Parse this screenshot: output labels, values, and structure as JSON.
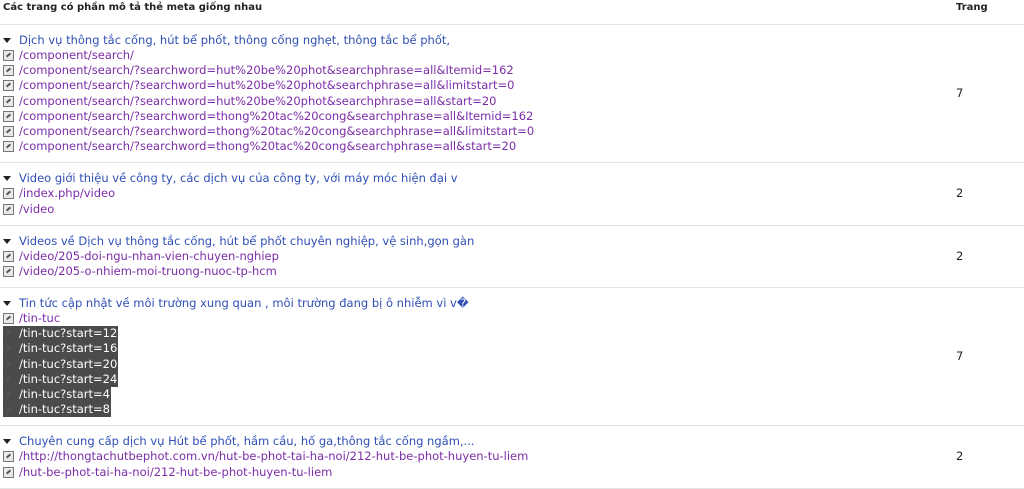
{
  "header": {
    "col_desc": "Các trang có phần mô tả thẻ meta giống nhau",
    "col_count": "Trang"
  },
  "groups": [
    {
      "title": "Dịch vụ thông tắc cống, hút bể phốt, thông cống nghẹt, thông tắc bể phốt,",
      "count": "7",
      "urls": [
        "/component/search/",
        "/component/search/?searchword=hut%20be%20phot&searchphrase=all&Itemid=162",
        "/component/search/?searchword=hut%20be%20phot&searchphrase=all&limitstart=0",
        "/component/search/?searchword=hut%20be%20phot&searchphrase=all&start=20",
        "/component/search/?searchword=thong%20tac%20cong&searchphrase=all&Itemid=162",
        "/component/search/?searchword=thong%20tac%20cong&searchphrase=all&limitstart=0",
        "/component/search/?searchword=thong%20tac%20cong&searchphrase=all&start=20"
      ]
    },
    {
      "title": "Video giới thiệu về công ty, các dịch vụ của công ty, với máy móc hiện đại v",
      "count": "2",
      "urls": [
        "/index.php/video",
        "/video"
      ]
    },
    {
      "title": "Videos về Dịch vụ thông tắc cống, hút bể phốt chuyên nghiệp, vệ sinh,gọn gàn",
      "count": "2",
      "urls": [
        "/video/205-doi-ngu-nhan-vien-chuyen-nghiep",
        "/video/205-o-nhiem-moi-truong-nuoc-tp-hcm"
      ]
    },
    {
      "title": "Tin tức cập nhật về môi trường xung quan , môi trường đang bị ô nhiễm vì v�",
      "count": "7",
      "urls": [
        "/tin-tuc",
        "/tin-tuc?start=12",
        "/tin-tuc?start=16",
        "/tin-tuc?start=20",
        "/tin-tuc?start=24",
        "/tin-tuc?start=4",
        "/tin-tuc?start=8"
      ],
      "selected_from": 1
    },
    {
      "title": "Chuyên cung cấp dịch vụ Hút bể phốt, hầm cầu, hố ga,thông tắc cống ngầm,...",
      "count": "2",
      "urls": [
        "/http://thongtachutbephot.com.vn/hut-be-phot-tai-ha-noi/212-hut-be-phot-huyen-tu-liem",
        "/hut-be-phot-tai-ha-noi/212-hut-be-phot-huyen-tu-liem"
      ]
    }
  ]
}
